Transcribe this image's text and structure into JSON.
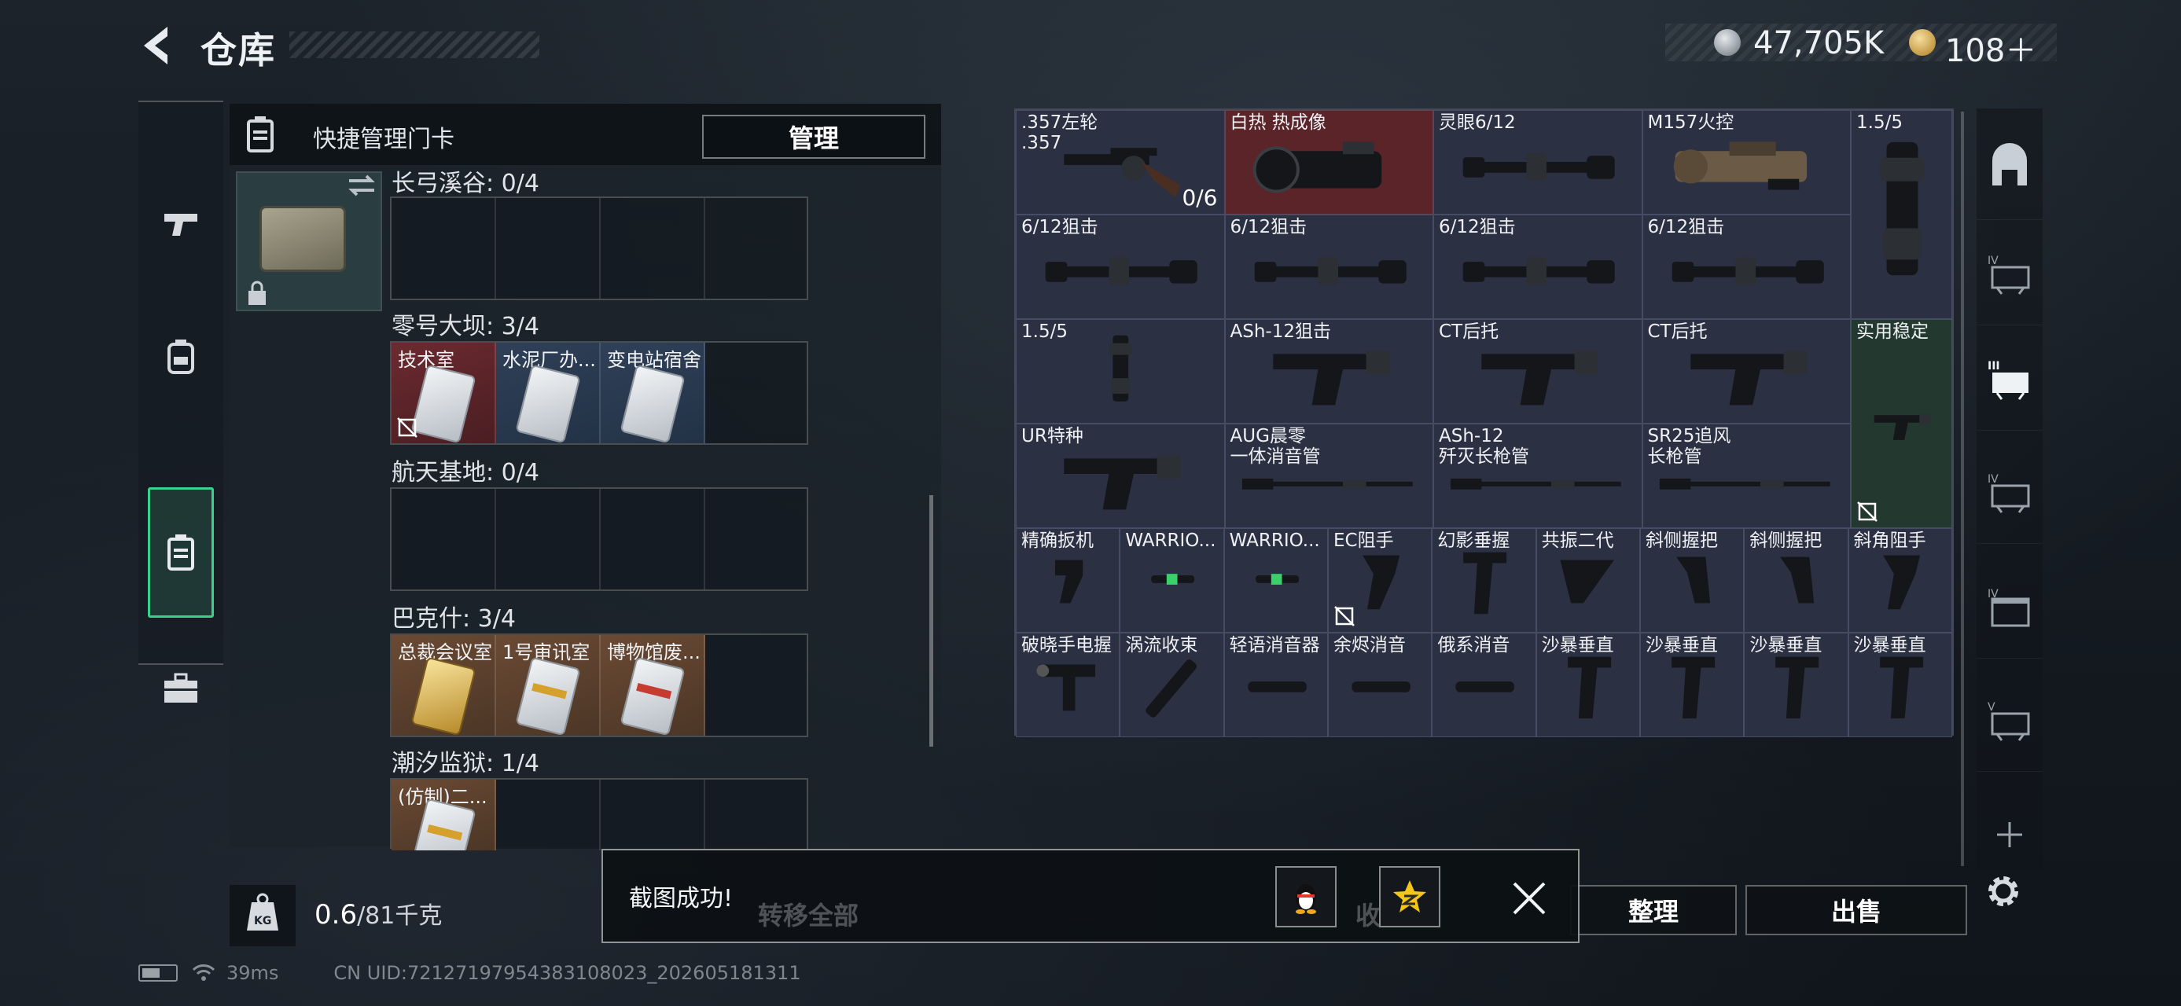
{
  "header": {
    "title": "仓库",
    "money": "47,705K",
    "tickets": "108＋"
  },
  "left_panel": {
    "header_label": "快捷管理门卡",
    "manage_label": "管理",
    "maps": [
      {
        "title": "长弓溪谷: 0/4",
        "slots": []
      },
      {
        "title": "零号大坝: 3/4",
        "slots": [
          {
            "name": "技术室",
            "color": "red",
            "disabled": true
          },
          {
            "name": "水泥厂办...",
            "color": "blue",
            "disabled": false
          },
          {
            "name": "变电站宿舍",
            "color": "blue",
            "disabled": false
          }
        ]
      },
      {
        "title": "航天基地: 0/4",
        "slots": []
      },
      {
        "title": "巴克什: 3/4",
        "slots": [
          {
            "name": "总裁会议室",
            "color": "brown",
            "card": "gold"
          },
          {
            "name": "1号审讯室",
            "color": "brown",
            "card": "gold-light"
          },
          {
            "name": "博物馆废...",
            "color": "brown",
            "card": "light"
          }
        ]
      },
      {
        "title": "潮汐监狱: 1/4",
        "slots": [
          {
            "name": "(仿制)二...",
            "color": "brown",
            "card": "light"
          }
        ]
      }
    ],
    "weight_current": "0.6",
    "weight_max": "/81千克"
  },
  "grid": {
    "items": [
      {
        "name": ".357左轮\n.357",
        "count": "0/6",
        "icon": "revolver-icon"
      },
      {
        "name": "白热 热成像",
        "icon": "thermal-scope-icon",
        "bg": "red"
      },
      {
        "name": "灵眼6/12",
        "icon": "scope-icon"
      },
      {
        "name": "M157火控",
        "icon": "fire-control-scope-icon"
      },
      {
        "name": "1.5/5",
        "icon": "large-scope-icon"
      },
      {
        "name": "6/12狙击",
        "icon": "scope-icon"
      },
      {
        "name": "6/12狙击",
        "icon": "scope-icon"
      },
      {
        "name": "6/12狙击",
        "icon": "scope-icon"
      },
      {
        "name": "6/12狙击",
        "icon": "scope-icon"
      },
      {
        "name": "1.5/5",
        "icon": "large-scope-icon"
      },
      {
        "name": "ASh-12狙击",
        "icon": "stock-icon"
      },
      {
        "name": "CT后托",
        "icon": "stock-icon"
      },
      {
        "name": "CT后托",
        "icon": "stock-icon"
      },
      {
        "name": "实用稳定",
        "icon": "stock-icon",
        "bg": "green",
        "disabled": true
      },
      {
        "name": "UR特种",
        "icon": "stock-icon"
      },
      {
        "name": "AUG晨零\n一体消音管",
        "icon": "barrel-icon"
      },
      {
        "name": "ASh-12\n歼灭长枪管",
        "icon": "barrel-icon"
      },
      {
        "name": "SR25追风\n长枪管",
        "icon": "barrel-icon"
      },
      {
        "name": "精确扳机",
        "icon": "trigger-icon"
      },
      {
        "name": "WARRIO...",
        "icon": "laser-icon"
      },
      {
        "name": "WARRIO...",
        "icon": "laser-icon"
      },
      {
        "name": "EC阻手",
        "icon": "handstop-icon",
        "disabled": true
      },
      {
        "name": "幻影垂握",
        "icon": "vertical-grip-icon"
      },
      {
        "name": "共振二代",
        "icon": "angled-grip-icon"
      },
      {
        "name": "斜侧握把",
        "icon": "grip-icon"
      },
      {
        "name": "斜侧握把",
        "icon": "grip-icon"
      },
      {
        "name": "斜角阻手",
        "icon": "handstop-icon"
      },
      {
        "name": "破晓手电握",
        "icon": "flashlight-grip-icon"
      },
      {
        "name": "涡流收束",
        "icon": "muzzle-icon"
      },
      {
        "name": "轻语消音器",
        "icon": "suppressor-icon"
      },
      {
        "name": "余烬消音",
        "icon": "suppressor-icon"
      },
      {
        "name": "俄系消音",
        "icon": "suppressor-icon"
      },
      {
        "name": "沙暴垂直",
        "icon": "vertical-grip-icon"
      },
      {
        "name": "沙暴垂直",
        "icon": "vertical-grip-icon"
      },
      {
        "name": "沙暴垂直",
        "icon": "vertical-grip-icon"
      },
      {
        "name": "沙暴垂直",
        "icon": "vertical-grip-icon"
      }
    ]
  },
  "bottom": {
    "sort_label": "整理",
    "sell_label": "出售",
    "transfer_label": "转移全部",
    "collect_label": "收藏室"
  },
  "toast": {
    "message": "截图成功!"
  },
  "status": {
    "ping": "39ms",
    "uid": "CN UID:72127197954383108023_202605181311"
  },
  "colors": {
    "accent": "#3bd18d",
    "item_cell": "#2b3043",
    "item_red": "#5a2429",
    "item_green": "#23392f"
  }
}
